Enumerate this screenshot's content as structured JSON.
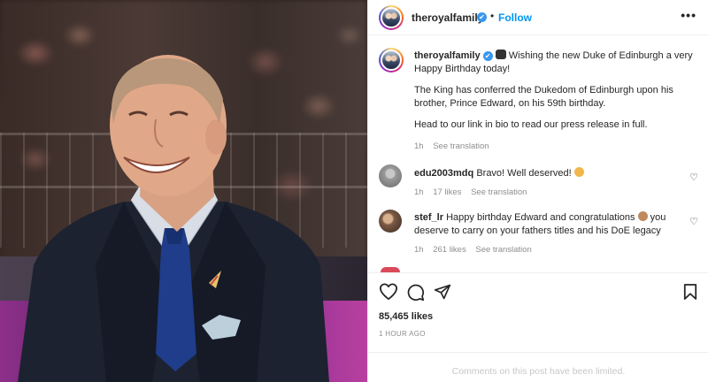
{
  "post": {
    "account": "theroyalfamily",
    "follow_label": "Follow",
    "more_label": "•••",
    "separator": "•",
    "caption": {
      "line1": "Wishing the new Duke of Edinburgh a very Happy Birthday today!",
      "line2": "The King has conferred the Dukedom of Edinburgh upon his brother, Prince Edward, on his 59th birthday.",
      "line3": "Head to our link in bio to read our press release in full.",
      "age": "1h",
      "see_translation": "See translation"
    },
    "comments": [
      {
        "user": "edu2003mdq",
        "text": "Bravo! Well deserved!",
        "age": "1h",
        "likes": "17 likes",
        "see_translation": "See translation"
      },
      {
        "user": "stef_lr",
        "text_a": "Happy birthday Edward and congratulations",
        "text_b": "you deserve to carry on your fathers titles and his DoE legacy",
        "age": "1h",
        "likes": "261 likes",
        "see_translation": "See translation"
      }
    ],
    "likes_count": "85,465 likes",
    "posted_time": "1 HOUR AGO",
    "comments_limited": "Comments on this post have been limited."
  },
  "icons": {
    "verified": "✔",
    "heart": "♡",
    "comment": "comment-icon",
    "share": "share-icon",
    "save": "bookmark-icon"
  },
  "colors": {
    "follow_blue": "#0095f6",
    "verified_blue": "#3897f0",
    "muted_gray": "#8e8e8e"
  }
}
